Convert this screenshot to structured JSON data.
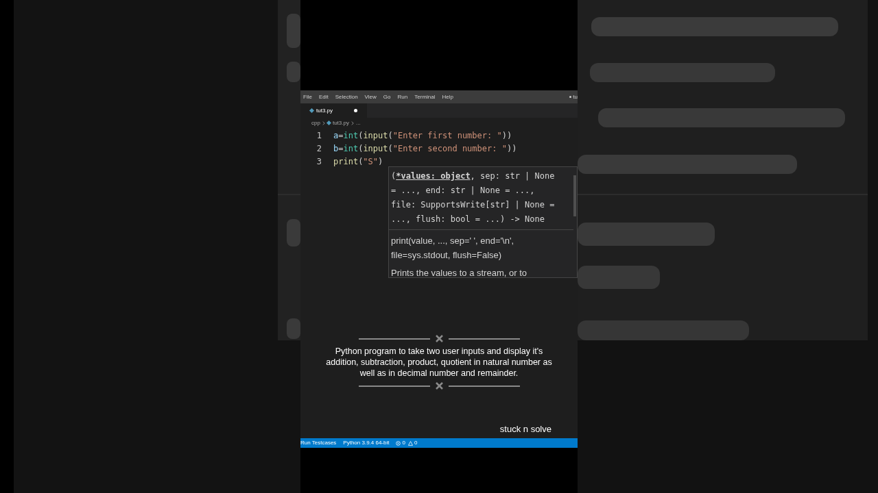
{
  "menu": [
    {
      "label": "File"
    },
    {
      "label": "Edit"
    },
    {
      "label": "Selection"
    },
    {
      "label": "View"
    },
    {
      "label": "Go"
    },
    {
      "label": "Run"
    },
    {
      "label": "Terminal"
    },
    {
      "label": "Help"
    }
  ],
  "title_fragment": "tu",
  "tabs": [
    {
      "label": "tut3.py",
      "selected": true,
      "modified": true
    }
  ],
  "breadcrumbs": [
    "cpp",
    "tut3.py",
    "..."
  ],
  "code_lines": [
    {
      "number": "1",
      "tokens": [
        {
          "text": "a",
          "kind": "var"
        },
        {
          "text": "=",
          "kind": "op"
        },
        {
          "text": "int",
          "kind": "type"
        },
        {
          "text": "(",
          "kind": "punc"
        },
        {
          "text": "input",
          "kind": "func"
        },
        {
          "text": "(",
          "kind": "punc"
        },
        {
          "text": "\"Enter first number: \"",
          "kind": "string"
        },
        {
          "text": "))",
          "kind": "punc"
        }
      ]
    },
    {
      "number": "2",
      "tokens": [
        {
          "text": "b",
          "kind": "var"
        },
        {
          "text": "=",
          "kind": "op"
        },
        {
          "text": "int",
          "kind": "type"
        },
        {
          "text": "(",
          "kind": "punc"
        },
        {
          "text": "input",
          "kind": "func"
        },
        {
          "text": "(",
          "kind": "punc"
        },
        {
          "text": "\"Enter second number: \"",
          "kind": "string"
        },
        {
          "text": "))",
          "kind": "punc"
        }
      ]
    },
    {
      "number": "3",
      "tokens": [
        {
          "text": "print",
          "kind": "func"
        },
        {
          "text": "(",
          "kind": "punc"
        },
        {
          "text": "\"S\"",
          "kind": "string"
        },
        {
          "text": ")",
          "kind": "punc"
        }
      ]
    }
  ],
  "hover": {
    "signature": [
      [
        {
          "text": "(",
          "active": false
        },
        {
          "text": "*values: object",
          "active": true
        },
        {
          "text": ", sep: str | None",
          "active": false
        }
      ],
      [
        {
          "text": "= ..., end: str | None = ...,",
          "active": false
        }
      ],
      [
        {
          "text": "file: SupportsWrite[str] | None =",
          "active": false
        }
      ],
      [
        {
          "text": "..., flush: bool = ...) -> None",
          "active": false
        }
      ]
    ],
    "doc": [
      "print(value, ..., sep=' ', end='\\n',",
      "file=sys.stdout, flush=False)",
      "Prints the values to a stream, or to"
    ]
  },
  "caption": "Python program to take two user inputs and display it's addition, subtraction, product, quotient in natural number as well as in decimal number and remainder.",
  "watermark_text": "stuck n solve",
  "status_bar": {
    "items": [
      "Run Testcases",
      "Python 3.9.4 64-bit"
    ],
    "errors": "0",
    "warnings": "0"
  }
}
